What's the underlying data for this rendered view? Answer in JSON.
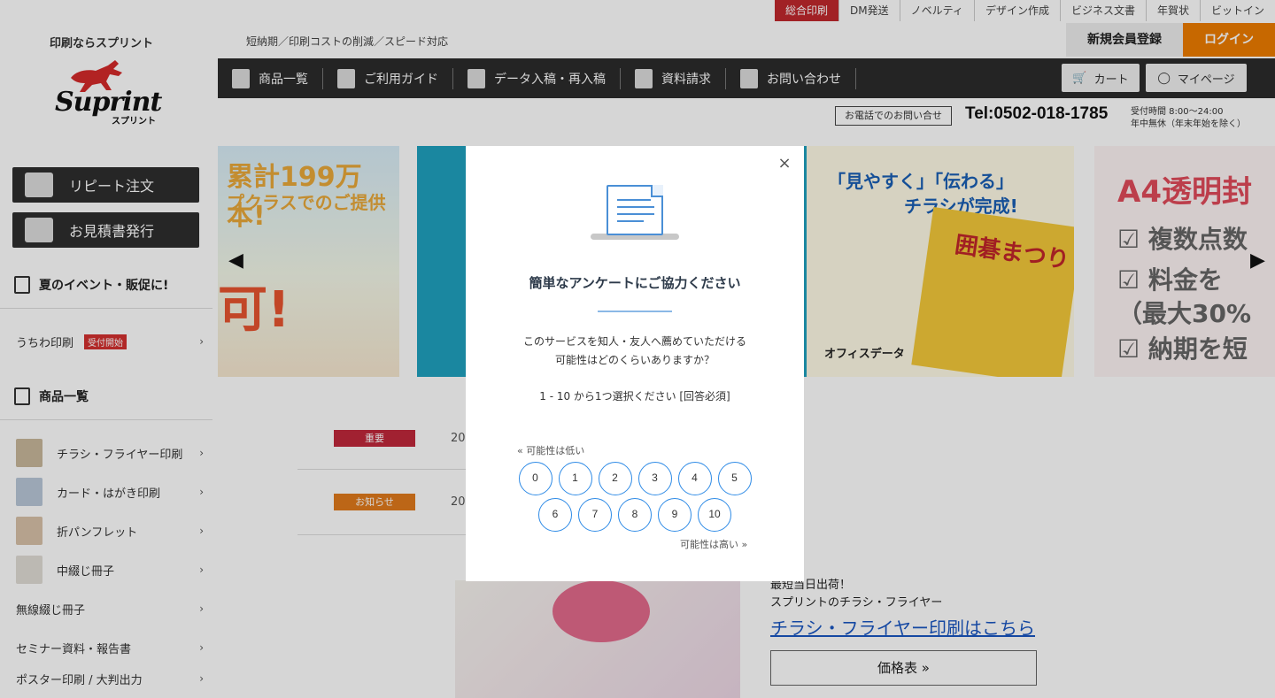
{
  "topbar": {
    "links": [
      "総合印刷",
      "DM発送",
      "ノベルティ",
      "デザイン作成",
      "ビジネス文書",
      "年賀状",
      "ビットイン"
    ],
    "active_index": 0,
    "tagline_left": "印刷ならスプリント",
    "tagline": "短納期／印刷コストの削減／スピード対応",
    "register": "新規会員登録",
    "login": "ログイン"
  },
  "logo": {
    "word": "Suprint",
    "sub": "スプリント"
  },
  "nav": {
    "items": [
      {
        "label": "商品一覧",
        "icon": "document-icon"
      },
      {
        "label": "ご利用ガイド",
        "icon": "gear-icon"
      },
      {
        "label": "データ入稿・再入稿",
        "icon": "upload-icon"
      },
      {
        "label": "資料請求",
        "icon": "clock-icon"
      },
      {
        "label": "お問い合わせ",
        "icon": "mail-icon"
      }
    ],
    "cart": "カート",
    "mypage": "マイページ"
  },
  "contact": {
    "phone_button": "お電話でのお問い合せ",
    "phone": "Tel:0502-018-1785",
    "hours_line1": "受付時間 8:00〜24:00",
    "hours_line2": "年中無休（年末年始を除く）"
  },
  "sidebar": {
    "repeat": "リピート注文",
    "estimate": "お見積書発行",
    "summer_head": "夏のイベント・販促に!",
    "uchiwa": "うちわ印刷",
    "uchiwa_badge": "受付開始",
    "products_head": "商品一覧",
    "items": [
      "チラシ・フライヤー印刷",
      "カード・はがき印刷",
      "折パンフレット",
      "中綴じ冊子",
      "無線綴じ冊子",
      "セミナー資料・報告書",
      "ポスター印刷 / 大判出力"
    ]
  },
  "banners": {
    "b1_t1": "累計199万本!",
    "b1_t2": "プクラスでのご提供",
    "b1_t3": "可!",
    "b3_t1": "「見やすく」「伝わる」",
    "b3_t2": "チラシが完成!",
    "b3_flyer": "囲碁まつり",
    "b3_office": "オフィスデータ",
    "b4_t1": "A4透明封",
    "b4_rows": [
      "☑ 複数点数",
      "☑ 料金を",
      "（最大30%",
      "☑ 納期を短"
    ]
  },
  "news": [
    {
      "badge": "重要",
      "date": "20",
      "color": "#c0283b"
    },
    {
      "badge": "お知らせ",
      "date": "20",
      "color": "#e07a1c"
    }
  ],
  "promo": {
    "line1": "最短当日出荷！",
    "line2": "スプリントのチラシ・フライヤー",
    "link": "チラシ・フライヤー印刷はこちら",
    "price": "価格表 »"
  },
  "modal": {
    "title": "簡単なアンケートにご協力ください",
    "q1": "このサービスを知人・友人へ薦めていただける",
    "q2": "可能性はどのくらいありますか？",
    "note": "1 - 10 から1つ選択ください [回答必須]",
    "low": "« 可能性は低い",
    "high": "可能性は高い »",
    "row1": [
      "0",
      "1",
      "2",
      "3",
      "4",
      "5"
    ],
    "row2": [
      "6",
      "7",
      "8",
      "9",
      "10"
    ],
    "close": "×",
    "accent": "#2f8be6"
  }
}
